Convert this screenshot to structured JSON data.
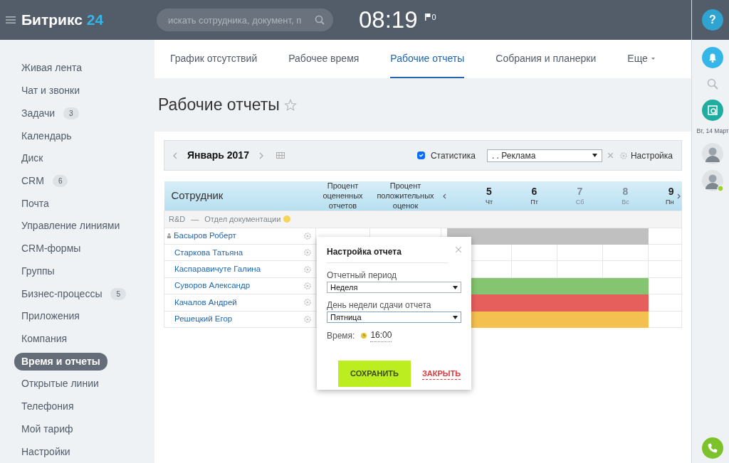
{
  "header": {
    "logo_text": "Битрикс",
    "logo_number": "24",
    "search": {
      "placeholder": "искать сотрудника, документ, п"
    },
    "clock": "08:19",
    "flag_count": "0"
  },
  "sidebar": {
    "items": [
      {
        "label": "Живая лента",
        "selected": false
      },
      {
        "label": "Чат и звонки",
        "selected": false
      },
      {
        "label": "Задачи",
        "count": "3",
        "selected": false
      },
      {
        "label": "Календарь",
        "selected": false
      },
      {
        "label": "Диск",
        "selected": false
      },
      {
        "label": "CRM",
        "count": "6",
        "selected": false
      },
      {
        "label": "Почта",
        "selected": false
      },
      {
        "label": "Управление линиями",
        "selected": false
      },
      {
        "label": "CRM-формы",
        "selected": false
      },
      {
        "label": "Группы",
        "selected": false
      },
      {
        "label": "Бизнес-процессы",
        "count": "5",
        "selected": false
      },
      {
        "label": "Приложения",
        "selected": false
      },
      {
        "label": "Компания",
        "selected": false
      },
      {
        "label": "Время и отчеты",
        "selected": true
      },
      {
        "label": "Открытые линии",
        "selected": false
      },
      {
        "label": "Телефония",
        "selected": false
      },
      {
        "label": "Мой тариф",
        "selected": false
      },
      {
        "label": "Настройки",
        "selected": false
      }
    ]
  },
  "tabs": [
    {
      "label": "График отсутствий",
      "selected": false
    },
    {
      "label": "Рабочее время",
      "selected": false
    },
    {
      "label": "Рабочие отчеты",
      "selected": true
    },
    {
      "label": "Собрания и планерки",
      "selected": false
    },
    {
      "label": "Еще",
      "selected": false,
      "dropdown": true
    }
  ],
  "page_title": "Рабочие отчеты",
  "toolbar": {
    "month": "Январь 2017",
    "statistics": {
      "label": "Статистика",
      "checked": true
    },
    "department_select": ". . Реклама",
    "settings": "Настройка"
  },
  "table": {
    "columns": [
      "Сотрудник",
      "Процент оцененных отчетов",
      "Процент положительных оценок"
    ],
    "days": [
      {
        "number": "5",
        "weekday": "Чт",
        "weekend": false
      },
      {
        "number": "6",
        "weekday": "Пт",
        "weekend": false
      },
      {
        "number": "7",
        "weekday": "Сб",
        "weekend": true
      },
      {
        "number": "8",
        "weekday": "Вс",
        "weekend": true
      },
      {
        "number": "9",
        "weekday": "Пн",
        "weekend": false
      }
    ],
    "group": {
      "company": "R&D",
      "separator": "—",
      "department": "Отдел документации"
    },
    "rows": [
      {
        "name": "Басыров Роберт",
        "head": true,
        "color": "#c0c0c0"
      },
      {
        "name": "Старкова Татьяна",
        "head": false
      },
      {
        "name": "Каспаравичуте Галина",
        "head": false
      },
      {
        "name": "Суворов Александр",
        "head": false,
        "color": "#85c470"
      },
      {
        "name": "Качалов Андрей",
        "head": false,
        "color": "#e65f5c"
      },
      {
        "name": "Решецкий Егор",
        "head": false,
        "color": "#f4c04f"
      }
    ]
  },
  "popup": {
    "title": "Настройка отчета",
    "period_label": "Отчетный период",
    "period_value": "Неделя",
    "day_label": "День недели сдачи отчета",
    "day_value": "Пятница",
    "time_label": "Время:",
    "time_value": "16:00",
    "save": "СОХРАНИТЬ",
    "close": "ЗАКРЫТЬ"
  },
  "right_panel": {
    "help": "?",
    "date": "Вт, 14 Март",
    "users": [
      {
        "online": false
      },
      {
        "online": true
      }
    ]
  }
}
